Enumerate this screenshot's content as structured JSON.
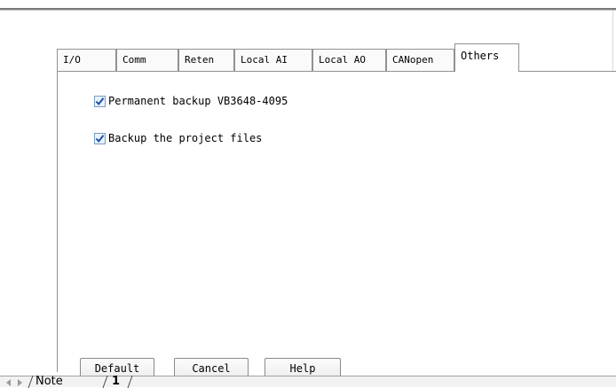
{
  "tabs": [
    {
      "label": "I/O",
      "active": false
    },
    {
      "label": "Comm",
      "active": false
    },
    {
      "label": "Reten",
      "active": false
    },
    {
      "label": "Local AI",
      "active": false
    },
    {
      "label": "Local AO",
      "active": false
    },
    {
      "label": "CANopen",
      "active": false
    },
    {
      "label": "Others",
      "active": true
    }
  ],
  "options": [
    {
      "label": "Permanent backup VB3648-4095",
      "checked": true
    },
    {
      "label": "Backup the project files",
      "checked": true
    }
  ],
  "buttons": {
    "default": "Default",
    "cancel": "Cancel",
    "help": "Help"
  },
  "sheet_tabs": [
    "Note",
    "1"
  ],
  "colors": {
    "check_mark": "#1f4fa6",
    "tab_border": "#919191"
  }
}
